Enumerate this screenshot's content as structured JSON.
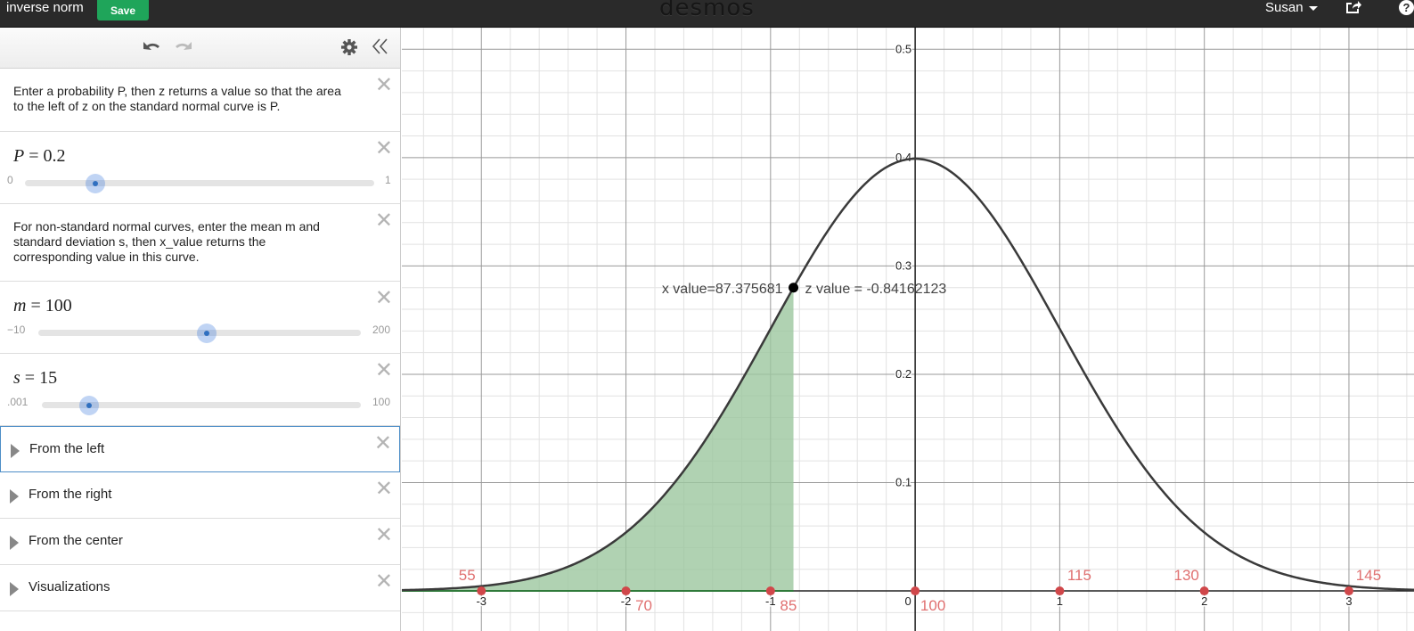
{
  "topbar": {
    "title": "inverse norm",
    "save_label": "Save",
    "logo": "desmos",
    "user": "Susan",
    "help_label": "?"
  },
  "toolbar": {
    "undo_icon": "undo-icon",
    "redo_icon": "redo-icon",
    "settings_icon": "gear-icon",
    "collapse_icon": "double-chevron-left-icon"
  },
  "expressions": [
    {
      "type": "note",
      "text": "Enter a probability P, then z returns a value so that the area to the left of z on the standard normal curve is P."
    },
    {
      "type": "slider",
      "variable": "P",
      "value": "0.2",
      "min": "0",
      "max": "1",
      "fraction": 0.2
    },
    {
      "type": "note",
      "text": "For non-standard normal curves, enter the mean m and standard deviation s, then x_value returns the corresponding value in this curve."
    },
    {
      "type": "slider",
      "variable": "m",
      "value": "100",
      "min": "−10",
      "max": "200",
      "fraction": 0.5238
    },
    {
      "type": "slider",
      "variable": "s",
      "value": "15",
      "min": ".001",
      "max": "100",
      "fraction": 0.15
    },
    {
      "type": "folder",
      "label": "From the left",
      "active": true
    },
    {
      "type": "folder",
      "label": "From the right"
    },
    {
      "type": "folder",
      "label": "From the center"
    },
    {
      "type": "folder",
      "label": "Visualizations"
    }
  ],
  "colors": {
    "save": "#1fa55a",
    "shade": "#9cc79f",
    "curve": "#3a3a3a",
    "points": "#d0474a",
    "point_labels": "#e07070",
    "slider": "#2f6fc0"
  },
  "chart_data": {
    "type": "line",
    "title": "",
    "xlabel": "",
    "ylabel": "",
    "xlim": [
      -3.55,
      3.45
    ],
    "ylim": [
      -0.037,
      0.52
    ],
    "x_ticks": [
      -3,
      -2,
      -1,
      0,
      1,
      2,
      3
    ],
    "y_ticks": [
      0.1,
      0.2,
      0.3,
      0.4,
      0.5
    ],
    "grid": true,
    "series": [
      {
        "name": "standard normal density",
        "function": "exp(-x^2/2)/sqrt(2*pi)",
        "color": "#3a3a3a"
      }
    ],
    "shaded_region": {
      "from": -3.55,
      "to": -0.84162123,
      "color": "#9cc79f"
    },
    "marked_point": {
      "x": -0.84162123,
      "y": 0.28
    },
    "annotations": {
      "x_value": "x value=87.375681",
      "z_value": "z value = -0.84162123"
    },
    "axis_points": [
      {
        "z": -3,
        "label": "55"
      },
      {
        "z": -2,
        "label": "70"
      },
      {
        "z": -1,
        "label": "85"
      },
      {
        "z": 0,
        "label": "100"
      },
      {
        "z": 1,
        "label": "115"
      },
      {
        "z": 2,
        "label": "130"
      },
      {
        "z": 3,
        "label": "145"
      }
    ]
  }
}
